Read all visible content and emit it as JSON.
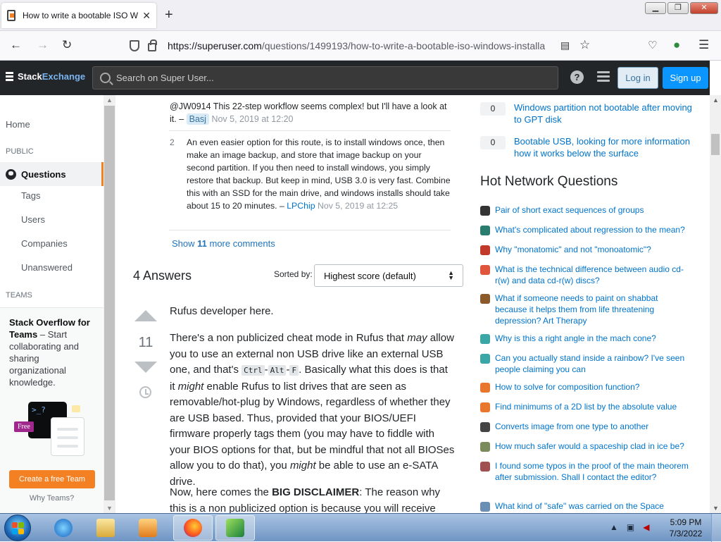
{
  "browser": {
    "tab_title": "How to write a bootable ISO Wi",
    "url_host": "https://superuser.com",
    "url_rest": "/questions/1499193/how-to-write-a-bootable-iso-windows-installa",
    "window_buttons": {
      "minimize": "▁",
      "maximize": "❐",
      "close": "✕"
    }
  },
  "header": {
    "logo_part1": "Stack",
    "logo_part2": "Exchange",
    "search_placeholder": "Search on Super User...",
    "help": "?",
    "login": "Log in",
    "signup": "Sign up"
  },
  "leftnav": {
    "home": "Home",
    "public_section": "PUBLIC",
    "questions": "Questions",
    "tags": "Tags",
    "users": "Users",
    "companies": "Companies",
    "unanswered": "Unanswered",
    "teams_section": "TEAMS",
    "team_title": "Stack Overflow for Teams",
    "team_text": " – Start collaborating and sharing organizational knowledge.",
    "team_free": "Free",
    "team_prompt": ">_?",
    "create_team": "Create a free Team",
    "why_teams": "Why Teams?"
  },
  "comments": [
    {
      "score": "",
      "text": "@JW0914 This 22-step workflow seems complex! but I'll have a look at it. –",
      "user": "Basj",
      "date": "Nov 5, 2019 at 12:20"
    },
    {
      "score": "2",
      "text": "An even easier option for this route, is to install windows once, then make an image backup, and store that image backup on your second partition. If you then need to install windows, you simply restore that backup. But keep in mind, USB 3.0 is very fast. Combine this with an SSD for the main drive, and windows installs should take about 15 to 20 minutes. –",
      "user": "LPChip",
      "date": "Nov 5, 2019 at 12:25"
    }
  ],
  "show_more": {
    "prefix": "Show ",
    "count": "11",
    "suffix": " more comments"
  },
  "answers": {
    "heading": "4 Answers",
    "sort_label": "Sorted by:",
    "sort_value": "Highest score (default)",
    "vote_count": "11",
    "p1": "Rufus developer here.",
    "p2_a": "There's a non publicized cheat mode in Rufus that ",
    "p2_may": "may",
    "p2_b": " allow you to use an external non USB drive like an external USB one, and that's ",
    "key_ctrl": "Ctrl",
    "key_alt": "Alt",
    "key_f": "F",
    "key_sep": "-",
    "p2_c": ". Basically what this does is that it ",
    "p2_might": "might",
    "p2_d": " enable Rufus to list drives that are seen as removable/hot-plug by Windows, regardless of whether they are USB based. Thus, provided that your BIOS/UEFI firmware properly tags them (you may have to fiddle with your BIOS options for that, but be mindful that not all BIOSes allow you to do that), you ",
    "p2_might2": "might",
    "p2_e": " be able to use an e-SATA drive.",
    "p3_a": "Now, here comes the ",
    "p3_big": "BIG DISCLAIMER",
    "p3_b": ": The reason why this is a non publicized option is because you will receive"
  },
  "related": [
    {
      "score": "0",
      "title": "Windows partition not bootable after moving to GPT disk"
    },
    {
      "score": "0",
      "title": "Bootable USB, looking for more information how it works below the surface"
    }
  ],
  "hnq": {
    "heading": "Hot Network Questions",
    "items": [
      {
        "title": "Pair of short exact sequences of groups",
        "icon": "mathoverflow-icon",
        "color": "#333333"
      },
      {
        "title": "What's complicated about regression to the mean?",
        "icon": "stats-icon",
        "color": "#2a7c6e"
      },
      {
        "title": "Why \"monatomic\" and not \"monoatomic\"?",
        "icon": "english-icon",
        "color": "#c0392b"
      },
      {
        "title": "What is the technical difference between audio cd-r(w) and data cd-r(w) discs?",
        "icon": "superuser-icon",
        "color": "#e0553b"
      },
      {
        "title": "What if someone needs to paint on shabbat because it helps them from life threatening depression? Art Therapy",
        "icon": "judaism-icon",
        "color": "#8b5a2b"
      },
      {
        "title": "Why is this a right angle in the mach cone?",
        "icon": "physics-icon",
        "color": "#3aa6a6"
      },
      {
        "title": "Can you actually stand inside a rainbow? I've seen people claiming you can",
        "icon": "physics-icon",
        "color": "#3aa6a6"
      },
      {
        "title": "How to solve for composition function?",
        "icon": "math-icon",
        "color": "#e8762d"
      },
      {
        "title": "Find minimums of a 2D list by the absolute value",
        "icon": "math-icon",
        "color": "#e8762d"
      },
      {
        "title": "Converts image from one type to another",
        "icon": "codegolf-icon",
        "color": "#444444"
      },
      {
        "title": "How much safer would a spaceship clad in ice be?",
        "icon": "worldbuilding-icon",
        "color": "#7a8a5a"
      },
      {
        "title": "I found some typos in the proof of the main theorem after submission. Shall I contact the editor?",
        "icon": "academia-icon",
        "color": "#a05050"
      },
      {
        "title": "What kind of \"safe\" was carried on the Space",
        "icon": "space-icon",
        "color": "#6a8fb3"
      }
    ]
  },
  "taskbar": {
    "time": "5:09 PM",
    "date": "7/3/2022"
  }
}
